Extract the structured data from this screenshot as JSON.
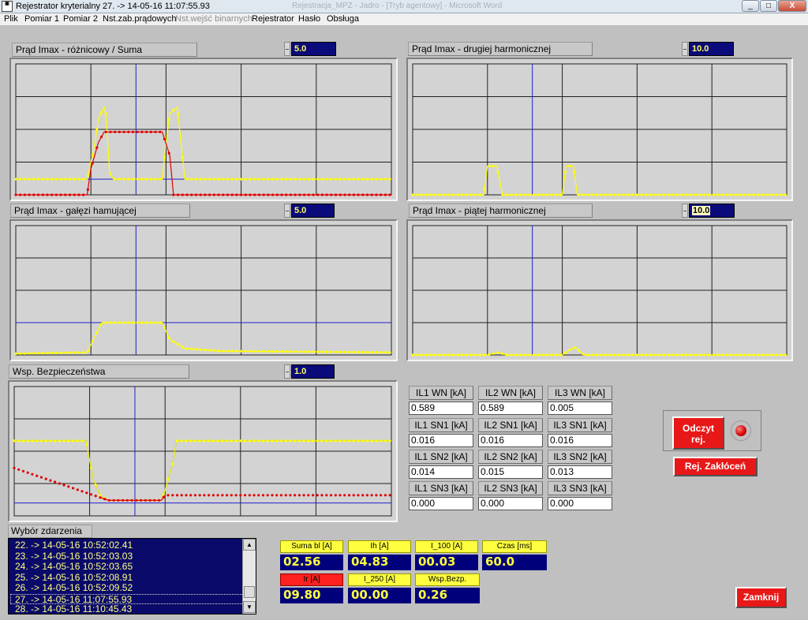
{
  "window": {
    "title": "Rejestrator kryterialny  27. -> 14-05-16 11:07:55.93",
    "title_ghost": "Rejestracja_MPZ - Jadro - [Tryb agentowy] - Microsoft Word",
    "minimize": "_",
    "maximize": "□",
    "close": "X"
  },
  "menu": {
    "items": [
      "Plik",
      "Pomiar 1",
      "Pomiar 2",
      "Nst.zab.prądowych",
      "Nst.wejść binarnych",
      "Rejestrator",
      "Hasło",
      "Obsługa"
    ],
    "disabled_index": 4
  },
  "panels": {
    "diff": {
      "label": "Prąd Imax - różnicowy /  Suma",
      "scale": "5.0"
    },
    "harm2": {
      "label": "Prąd Imax - drugiej harmonicznej",
      "scale": "10.0"
    },
    "brake": {
      "label": "Prąd Imax - gałęzi hamującej",
      "scale": "5.0"
    },
    "harm5": {
      "label": "Prąd Imax - piątej harmonicznej",
      "scale": "10.0"
    },
    "safety": {
      "label": "Wsp. Bezpieczeństwa",
      "scale": "1.0"
    }
  },
  "values": [
    {
      "label": "IL1 WN [kA]",
      "value": "0.589"
    },
    {
      "label": "IL2 WN [kA]",
      "value": "0.589"
    },
    {
      "label": "IL3 WN [kA]",
      "value": "0.005"
    },
    {
      "label": "IL1 SN1 [kA]",
      "value": "0.016"
    },
    {
      "label": "IL2 SN1 [kA]",
      "value": "0.016"
    },
    {
      "label": "IL3 SN1 [kA]",
      "value": "0.016"
    },
    {
      "label": "IL1 SN2 [kA]",
      "value": "0.014"
    },
    {
      "label": "IL2 SN2 [kA]",
      "value": "0.015"
    },
    {
      "label": "IL3 SN2 [kA]",
      "value": "0.013"
    },
    {
      "label": "IL1 SN3 [kA]",
      "value": "0.000"
    },
    {
      "label": "IL2 SN3 [kA]",
      "value": "0.000"
    },
    {
      "label": "IL3 SN3 [kA]",
      "value": "0.000"
    }
  ],
  "buttons": {
    "odczyt_line1": "Odczyt",
    "odczyt_line2": "rej.",
    "rej_zaklocen": "Rej. Zakłóceń",
    "zamknij": "Zamknij"
  },
  "events": {
    "header": "Wybór zdarzenia",
    "items": [
      "22. -> 14-05-16 10:52:02.41",
      "23. -> 14-05-16 10:52:03.03",
      "24. -> 14-05-16 10:52:03.65",
      "25. -> 14-05-16 10:52:08.91",
      "26. -> 14-05-16 10:52:09.52",
      "27. -> 14-05-16 11:07:55.93",
      "28. -> 14-05-16 11:10:45.43"
    ],
    "selected_index": 5
  },
  "measurements": [
    {
      "label": "Suma bl [A]",
      "value": "02.56"
    },
    {
      "label": "Ih [A]",
      "value": "04.83"
    },
    {
      "label": "I_100 [A]",
      "value": "00.03"
    },
    {
      "label": "Czas [ms]",
      "value": "60.0"
    },
    {
      "label": "Ir [A]",
      "value": "09.80",
      "highlight": "red"
    },
    {
      "label": "I_250 [A]",
      "value": "00.00"
    },
    {
      "label": "Wsp.Bezp.",
      "value": "0.26"
    }
  ],
  "colors": {
    "trace_yellow": "#ffff00",
    "trace_red": "#e00000",
    "cursor_blue": "#2020d0",
    "grid": "#202020",
    "field_navy": "#00007a"
  }
}
